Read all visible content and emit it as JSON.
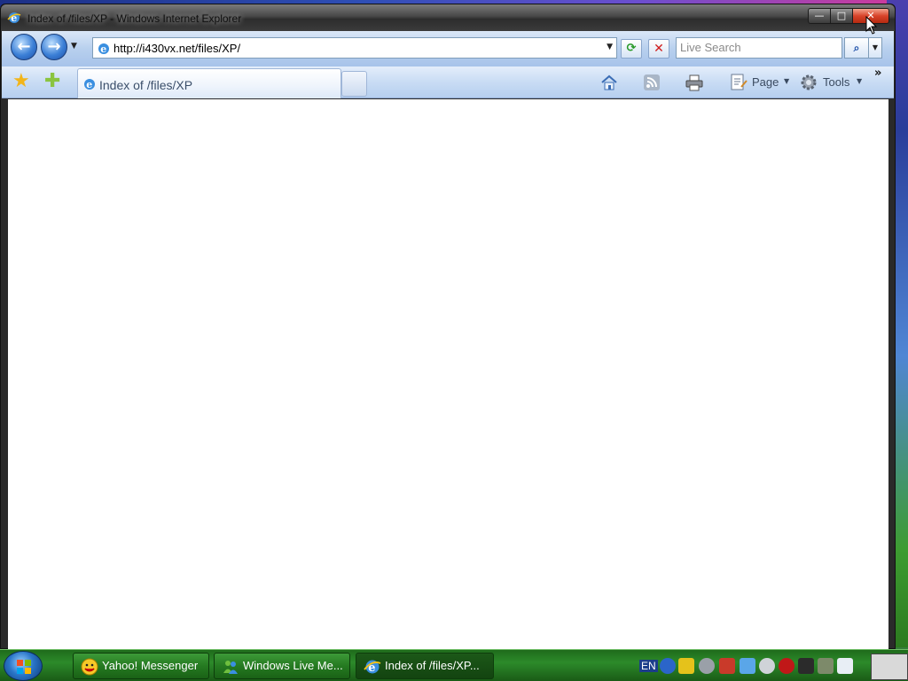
{
  "window": {
    "title": "Index of /files/XP - Windows Internet Explorer",
    "controls": {
      "minimize": "—",
      "maximize": "□",
      "close": "✕"
    }
  },
  "navbar": {
    "back_glyph": "←",
    "forward_glyph": "→",
    "address_url": "http://i430vx.net/files/XP/",
    "search_placeholder": "Live Search",
    "refresh_glyph": "⟳",
    "stop_glyph": "✕",
    "search_glyph": "⌕"
  },
  "cmdbar": {
    "favorites_glyph": "★",
    "add_favorites_glyph": "✚",
    "tab_label": "Index of /files/XP",
    "page_label": "Page",
    "tools_label": "Tools",
    "chevrons": "»"
  },
  "taskbar": {
    "buttons": [
      {
        "label": "Yahoo! Messenger",
        "icon": "yahoo-messenger-icon"
      },
      {
        "label": "Windows Live Me...",
        "icon": "windows-live-messenger-icon"
      },
      {
        "label": "Index of /files/XP...",
        "icon": "internet-explorer-icon"
      }
    ],
    "tray": {
      "language": "EN"
    }
  },
  "colors": {
    "titlebar": "#3b3b3b",
    "navbar": "#b8d0ee",
    "taskbar": "#2c8a2a",
    "close": "#d8432a"
  }
}
